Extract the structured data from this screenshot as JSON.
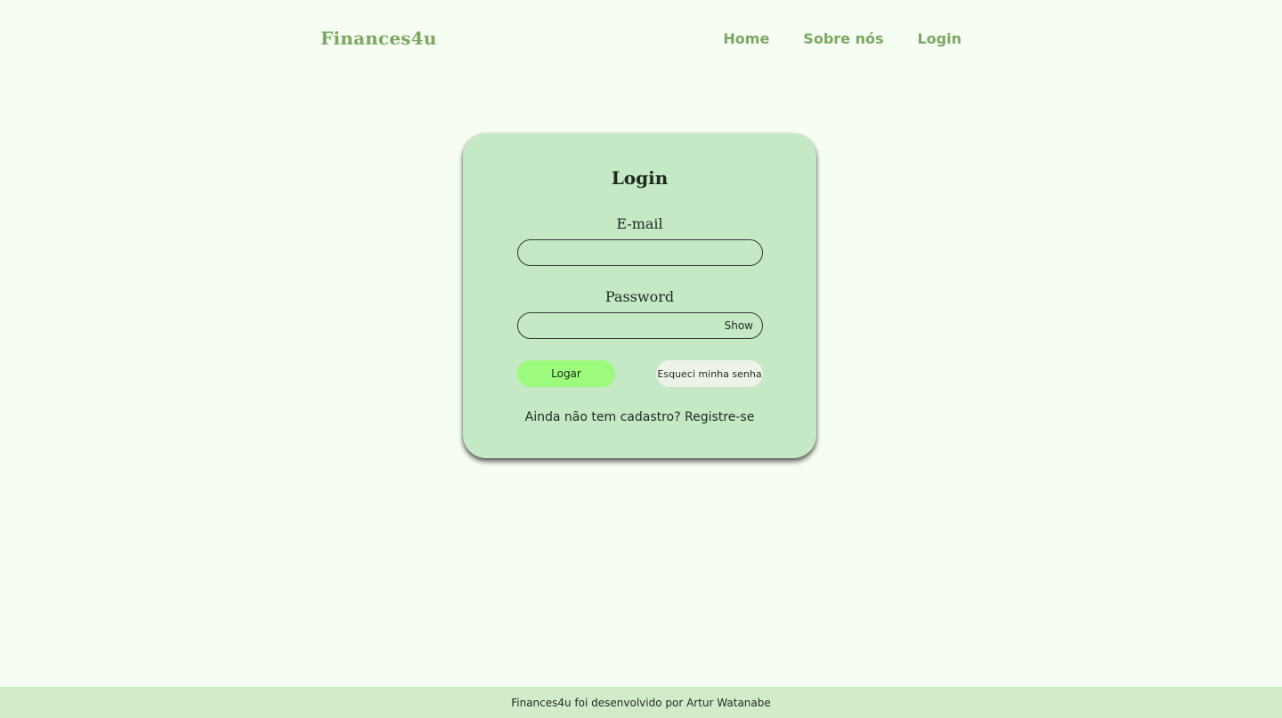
{
  "header": {
    "brand": "Finances4u",
    "nav": [
      {
        "label": "Home"
      },
      {
        "label": "Sobre nós"
      },
      {
        "label": "Login"
      }
    ]
  },
  "login_card": {
    "title": "Login",
    "email": {
      "label": "E-mail",
      "value": "",
      "placeholder": ""
    },
    "password": {
      "label": "Password",
      "value": "",
      "placeholder": "",
      "toggle_label": "Show"
    },
    "submit_label": "Logar",
    "forgot_label": "Esqueci minha senha",
    "register_prompt": "Ainda não tem cadastro?",
    "register_link": "Registre-se"
  },
  "footer": {
    "text": "Finances4u foi desenvolvido por Artur Watanabe"
  },
  "colors": {
    "background": "#f6fdf2",
    "brand_green": "#7aa862",
    "card": "#c4e9c4",
    "login_button": "#9cfb7c",
    "forgot_button": "#eef3ea",
    "footer": "#d2ecca"
  }
}
